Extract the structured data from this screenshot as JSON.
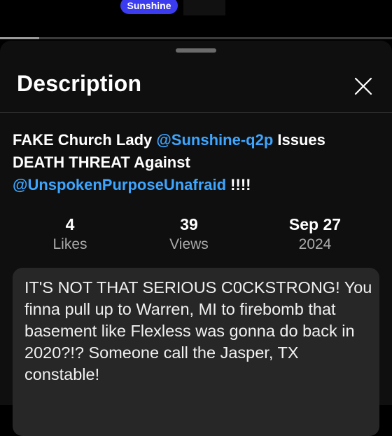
{
  "top": {
    "channel_chip": "Sunshine",
    "progress_fraction": 0.1
  },
  "sheet": {
    "title": "Description",
    "close_icon": "close-icon"
  },
  "video": {
    "title_parts": {
      "prefix": "FAKE Church Lady ",
      "mention1": "@Sunshine-q2p",
      "middle": " Issues DEATH THREAT Against ",
      "mention2": "@UnspokenPurposeUnafraid",
      "suffix": " !!!!"
    },
    "stats": {
      "likes_value": "4",
      "likes_label": "Likes",
      "views_value": "39",
      "views_label": "Views",
      "date_value": "Sep 27",
      "date_year": "2024"
    },
    "description": "IT'S NOT THAT SERIOUS C0CKSTRONG! You finna pull up to Warren, MI to firebomb that basement like Flexless was gonna do back in 2020?!? Someone call the Jasper, TX constable!"
  },
  "colors": {
    "accent_link": "#3ea6ff",
    "chip": "#3b3bf0",
    "sheet_bg": "#0f0f0f",
    "box_bg": "#272727"
  }
}
